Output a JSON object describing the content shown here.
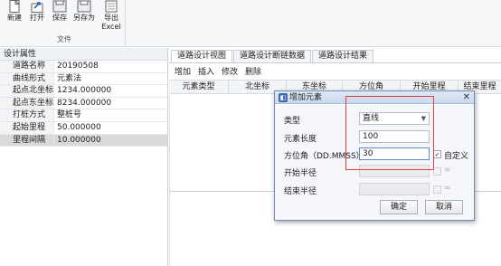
{
  "ribbon": {
    "buttons": [
      {
        "label": "新建",
        "icon": "new-file-icon"
      },
      {
        "label": "打开",
        "icon": "open-arrow-icon"
      },
      {
        "label": "保存",
        "icon": "save-icon"
      },
      {
        "label": "另存为",
        "icon": "save-as-icon"
      },
      {
        "label": "导出",
        "label2": "Excel",
        "icon": "export-excel-icon"
      }
    ],
    "group_label": "文件"
  },
  "properties": {
    "title": "设计属性",
    "rows": [
      {
        "key": "道路名称",
        "value": "20190508"
      },
      {
        "key": "曲线形式",
        "value": "元素法"
      },
      {
        "key": "起点北坐标",
        "value": "1234.000000"
      },
      {
        "key": "起点东坐标",
        "value": "8234.000000"
      },
      {
        "key": "打桩方式",
        "value": "整桩号"
      },
      {
        "key": "起始里程",
        "value": "50.000000"
      },
      {
        "key": "里程间隔",
        "value": "10.000000"
      }
    ]
  },
  "tabs": [
    {
      "label": "道路设计视图",
      "active": true
    },
    {
      "label": "道路设计断链数据",
      "active": false
    },
    {
      "label": "道路设计结果",
      "active": false
    }
  ],
  "toolbar": {
    "add": "增加",
    "insert": "插入",
    "modify": "修改",
    "delete": "删除"
  },
  "grid": {
    "columns": [
      "元素类型",
      "北坐标",
      "东坐标",
      "方位角",
      "开始里程",
      "结束里程"
    ]
  },
  "dialog": {
    "title": "增加元素",
    "type_label": "类型",
    "type_value": "直线",
    "length_label": "元素长度",
    "length_value": "100",
    "azimuth_label": "方位角（DD.MMSS）",
    "azimuth_value": "30",
    "custom_label": "自定义",
    "custom_checked": true,
    "start_radius_label": "开始半径",
    "end_radius_label": "结束半径",
    "infinity": "∞",
    "ok": "确定",
    "cancel": "取消"
  },
  "colors": {
    "highlight": "#e2403a",
    "accent": "#3a6cb0"
  }
}
